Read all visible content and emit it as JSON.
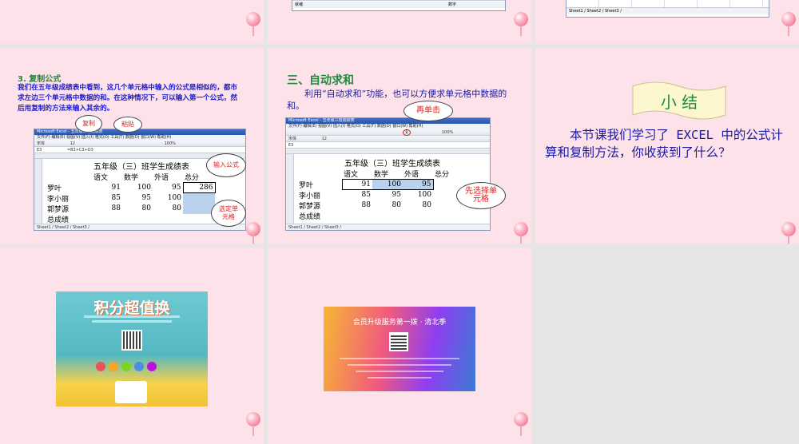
{
  "slides": {
    "s4": {
      "heading": "3. 复制公式",
      "body": "我们在五年级成绩表中看到，这几个单元格中输入的公式是相似的，都市求左边三个单元格中数据的和。在这种情况下，可以输入第一个公式，然后用复制的方法来输入其余的。",
      "callout_copy": "复制",
      "callout_paste": "粘贴",
      "callout_input": "输入公式",
      "callout_select": "选定单元格",
      "sum_first": "286"
    },
    "s5": {
      "heading": "三、自动求和",
      "body": "利用“自动求和”功能，也可以方便求单元格中数据的和。",
      "callout_click": "再单击",
      "callout_select": "先选择单元格"
    },
    "s6": {
      "heading": "小 结",
      "body": "本节课我们学习了 EXCEL 中的公式计算和复制方法，你收获到了什么？"
    },
    "s7": {
      "title": "积分超值换"
    },
    "s8": {
      "title": "会员升级服务第一拨 · 清北季"
    }
  },
  "table": {
    "title": "五年级（三）班学生成绩表",
    "headers": [
      "语文",
      "数学",
      "外语",
      "总分"
    ],
    "rows": [
      {
        "name": "罗叶",
        "yw": "91",
        "sx": "100",
        "wy": "95"
      },
      {
        "name": "李小丽",
        "yw": "85",
        "sx": "95",
        "wy": "100"
      },
      {
        "name": "郭梦源",
        "yw": "88",
        "sx": "80",
        "wy": "80"
      },
      {
        "name": "总成绩",
        "yw": "",
        "sx": "",
        "wy": ""
      }
    ]
  },
  "excel": {
    "window_title": "Microsoft Excel - 五年级三班成绩表",
    "menu": "文件(F)  编辑(E)  视图(V)  插入(I)  格式(O)  工具(T)  数据(D)  窗口(W)  帮助(H)",
    "sheet_tabs": "Sheet1 / Sheet2 / Sheet3 /",
    "status": "就绪",
    "status_num": "数字",
    "zoom": "100%",
    "font_name": "宋体",
    "font_size": "12",
    "cell_ref_a": "E3",
    "formula_a": "=B3+C3+D3",
    "cell_ref_b": "E3"
  },
  "colors": {
    "slide_bg": "#fde2ea",
    "heading_green": "#1e8a3c",
    "body_blue": "#1a1ad0",
    "body_dark_blue": "#1a1aa0"
  }
}
